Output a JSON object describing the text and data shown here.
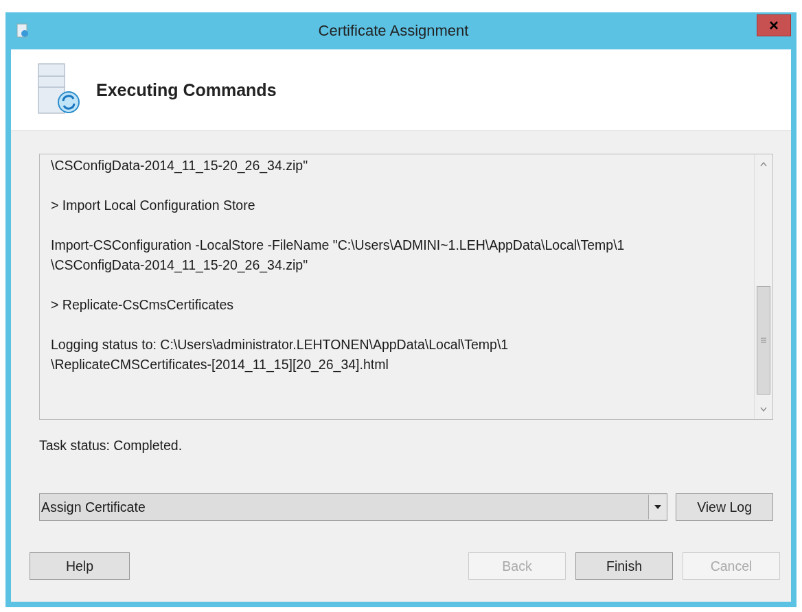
{
  "window": {
    "title": "Certificate Assignment"
  },
  "header": {
    "title": "Executing Commands"
  },
  "log": [
    {
      "lines": [
        "\\CSConfigData-2014_11_15-20_26_34.zip\""
      ]
    },
    {
      "lines": [
        "> Import Local Configuration Store"
      ]
    },
    {
      "lines": [
        "Import-CSConfiguration -LocalStore -FileName \"C:\\Users\\ADMINI~1.LEH\\AppData\\Local\\Temp\\1",
        "\\CSConfigData-2014_11_15-20_26_34.zip\""
      ]
    },
    {
      "lines": [
        "> Replicate-CsCmsCertificates"
      ]
    },
    {
      "lines": [
        "Logging status to: C:\\Users\\administrator.LEHTONEN\\AppData\\Local\\Temp\\1",
        "\\ReplicateCMSCertificates-[2014_11_15][20_26_34].html"
      ]
    }
  ],
  "task_status": "Task status: Completed.",
  "action_dropdown": {
    "value": "Assign Certificate"
  },
  "view_log_button": {
    "label": "View Log",
    "disabled": false
  },
  "buttons": [
    {
      "label": "Help",
      "disabled": false
    },
    {
      "label": "Back",
      "disabled": true
    },
    {
      "label": "Finish",
      "disabled": false
    },
    {
      "label": "Cancel",
      "disabled": true
    }
  ]
}
